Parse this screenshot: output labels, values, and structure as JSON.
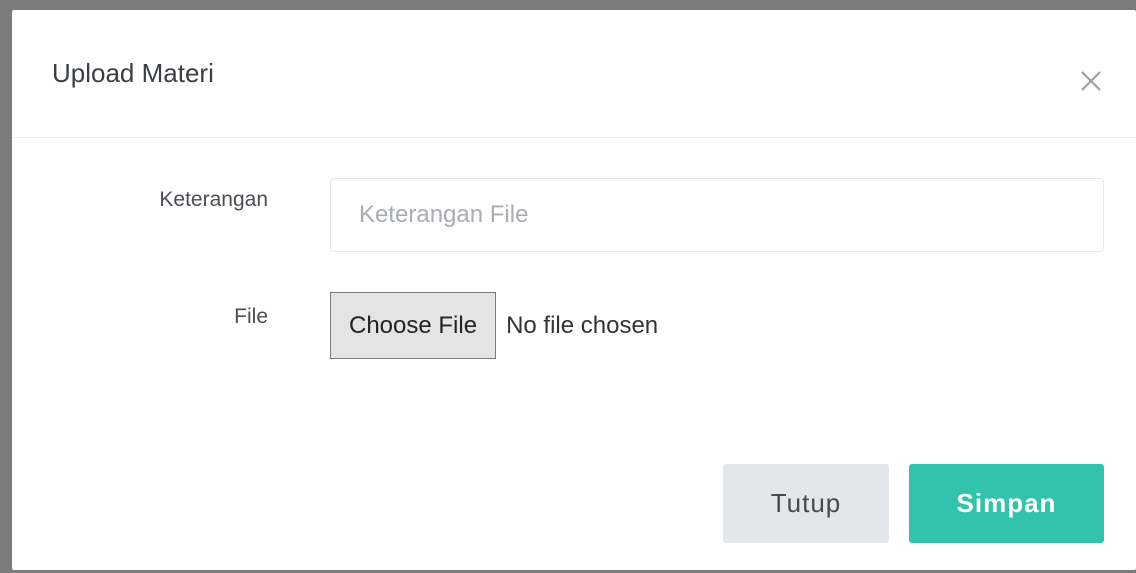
{
  "modal": {
    "title": "Upload Materi",
    "close_icon": "close-icon"
  },
  "form": {
    "keterangan_label": "Keterangan",
    "keterangan_placeholder": "Keterangan File",
    "keterangan_value": "",
    "file_label": "File",
    "choose_file_label": "Choose File",
    "file_status": "No file chosen"
  },
  "footer": {
    "close_label": "Tutup",
    "save_label": "Simpan"
  },
  "colors": {
    "primary": "#33c3ad",
    "secondary": "#e4e7ea",
    "backdrop": "#7b7b7b"
  }
}
